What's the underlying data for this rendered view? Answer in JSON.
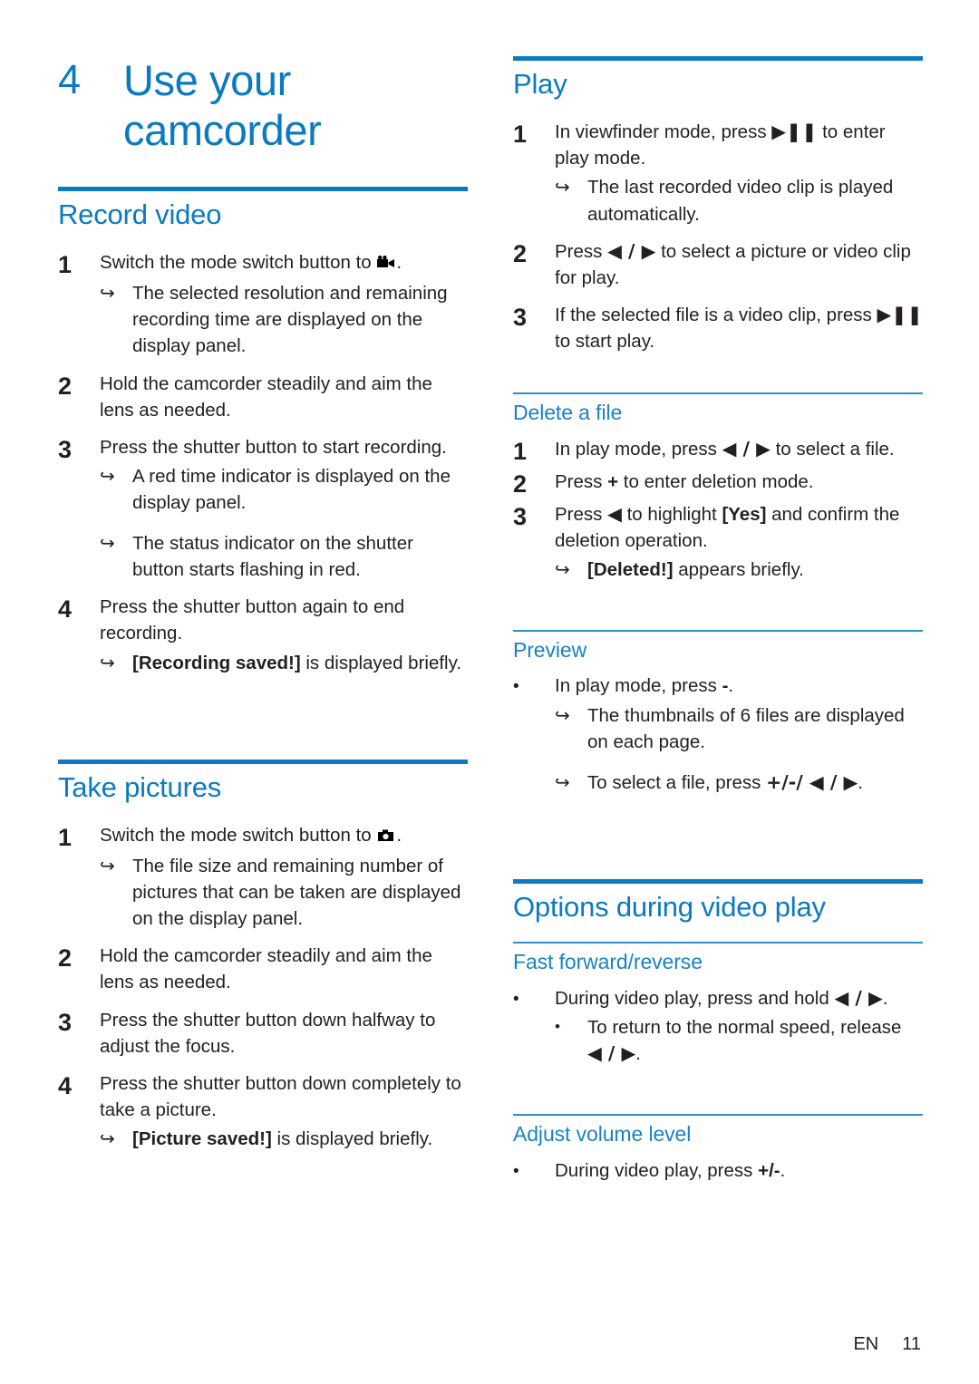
{
  "chapter": {
    "number": "4",
    "title": "Use your camcorder"
  },
  "footer": {
    "language": "EN",
    "page_number": "11"
  },
  "left_column": {
    "sections": [
      {
        "heading": "Record video",
        "steps": [
          {
            "marker": "1",
            "text_before_icon": "Switch the mode switch button to ",
            "icon": "video-camera-icon",
            "text_after_icon": ".",
            "substeps": [
              {
                "marker": "arrow",
                "text": "The selected resolution and remaining recording time are displayed on the display panel."
              }
            ]
          },
          {
            "marker": "2",
            "text": "Hold the camcorder steadily and aim the lens as needed."
          },
          {
            "marker": "3",
            "text": "Press the shutter button to start recording.",
            "substeps": [
              {
                "marker": "arrow",
                "text": "A red time indicator is displayed on the display panel."
              },
              {
                "marker": "arrow",
                "text": "The status indicator on the shutter button starts flashing in red."
              }
            ]
          },
          {
            "marker": "4",
            "text": "Press the shutter button again to end recording.",
            "substeps": [
              {
                "marker": "arrow",
                "bold": "[Recording saved!]",
                "text": " is displayed briefly."
              }
            ]
          }
        ]
      },
      {
        "heading": "Take pictures",
        "steps": [
          {
            "marker": "1",
            "text_before_icon": "Switch the mode switch button to ",
            "icon": "photo-camera-icon",
            "text_after_icon": ".",
            "substeps": [
              {
                "marker": "arrow",
                "text": "The file size and remaining number of pictures that can be taken are displayed on the display panel."
              }
            ]
          },
          {
            "marker": "2",
            "text": "Hold the camcorder steadily and aim the lens as needed."
          },
          {
            "marker": "3",
            "text": "Press the shutter button down halfway to adjust the focus."
          },
          {
            "marker": "4",
            "text": "Press the shutter button down completely to take a picture.",
            "substeps": [
              {
                "marker": "arrow",
                "bold": "[Picture saved!]",
                "text": " is displayed briefly."
              }
            ]
          }
        ]
      }
    ]
  },
  "right_column": {
    "play_section": {
      "heading": "Play",
      "steps": [
        {
          "marker": "1",
          "parts": [
            "In viewfinder mode, press ",
            "▶❚❚",
            " to enter play mode."
          ],
          "substeps": [
            {
              "marker": "arrow",
              "text": "The last recorded video clip is played automatically."
            }
          ]
        },
        {
          "marker": "2",
          "parts": [
            "Press ",
            "◀ / ▶",
            " to select a picture or video clip for play."
          ]
        },
        {
          "marker": "3",
          "parts": [
            "If the selected file is a video clip, press ",
            "▶❚❚",
            " to start play."
          ]
        }
      ]
    },
    "delete_section": {
      "heading": "Delete a file",
      "steps": [
        {
          "marker": "1",
          "parts": [
            "In play mode, press ",
            "◀ / ▶",
            " to select a file."
          ]
        },
        {
          "marker": "2",
          "parts": [
            "Press ",
            "+",
            " to enter deletion mode."
          ]
        },
        {
          "marker": "3",
          "parts": [
            "Press ",
            "◀",
            " to highlight ",
            "[Yes]",
            " and confirm the deletion operation."
          ],
          "substeps": [
            {
              "marker": "arrow",
              "bold": "[Deleted!]",
              "text": " appears briefly."
            }
          ]
        }
      ]
    },
    "preview_section": {
      "heading": "Preview",
      "steps": [
        {
          "marker": "bullet",
          "parts": [
            "In play mode, press ",
            "-",
            "."
          ],
          "substeps": [
            {
              "marker": "arrow",
              "text": "The thumbnails of 6 files are displayed on each page."
            },
            {
              "marker": "arrow",
              "text_before": "To select a file, press ",
              "bold": "+/-/ ◀ / ▶",
              "text_after": "."
            }
          ]
        }
      ]
    },
    "options_section": {
      "heading": "Options during video play",
      "subsections": [
        {
          "heading": "Fast forward/reverse",
          "steps": [
            {
              "marker": "bullet",
              "parts": [
                "During video play, press and hold ",
                "◀ / ▶",
                "."
              ],
              "substeps": [
                {
                  "marker": "dot",
                  "text_before": "To return to the normal speed, release ",
                  "bold": "◀ / ▶",
                  "text_after": "."
                }
              ]
            }
          ]
        },
        {
          "heading": "Adjust volume level",
          "steps": [
            {
              "marker": "bullet",
              "parts": [
                "During video play, press ",
                "+/-",
                "."
              ]
            }
          ]
        }
      ]
    }
  }
}
